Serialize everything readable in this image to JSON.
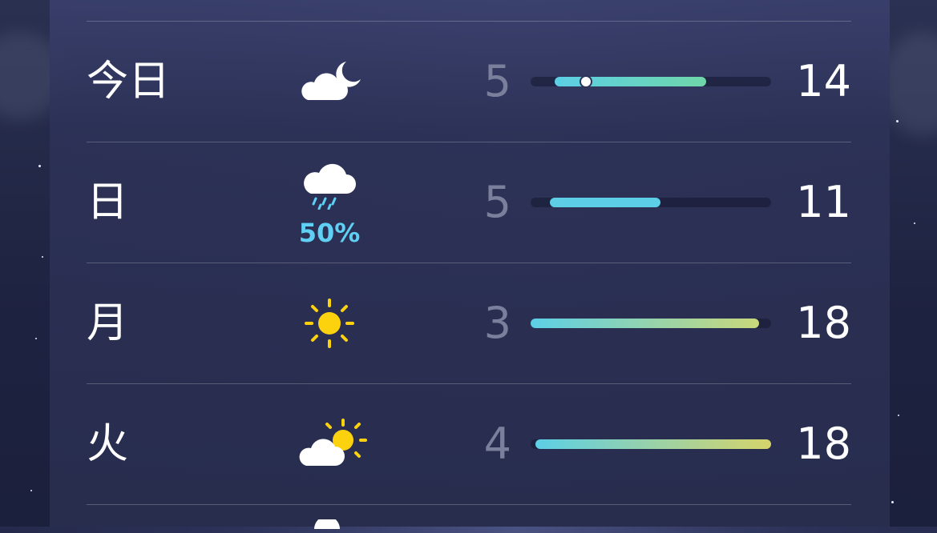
{
  "forecast": [
    {
      "day": "今日",
      "icon": "partly-cloudy-night-icon",
      "low": "5",
      "high": "14",
      "precip": "",
      "range": [
        0.1,
        0.73
      ],
      "current": 0.23,
      "color": "#5ccfe6",
      "color_end": "#6fd6a9"
    },
    {
      "day": "日",
      "icon": "rain-cloud-icon",
      "low": "5",
      "high": "11",
      "precip": "50%",
      "range": [
        0.08,
        0.54
      ],
      "current": null,
      "color": "#5ccfe6",
      "color_end": "#5ccfe6"
    },
    {
      "day": "月",
      "icon": "sun-icon",
      "low": "3",
      "high": "18",
      "precip": "",
      "range": [
        0.0,
        0.95
      ],
      "current": null,
      "color": "#5ccfe6",
      "color_end": "#c9d77a"
    },
    {
      "day": "火",
      "icon": "partly-sunny-icon",
      "low": "4",
      "high": "18",
      "precip": "",
      "range": [
        0.02,
        1.0
      ],
      "current": null,
      "color": "#5ccfe6",
      "color_end": "#d6d46a"
    }
  ]
}
